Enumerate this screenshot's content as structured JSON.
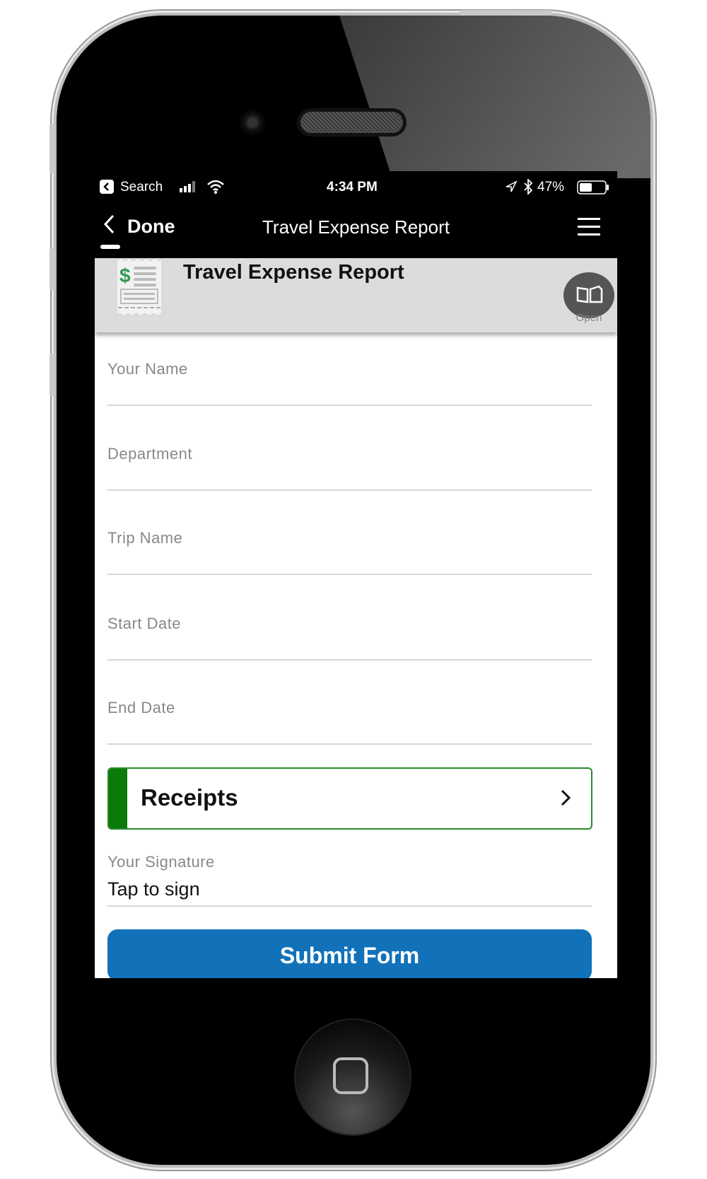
{
  "status_bar": {
    "back_app": "Search",
    "time": "4:34 PM",
    "battery": "47%",
    "battery_level": 0.47,
    "icons": [
      "back-to-app-icon",
      "signal-icon",
      "wifi-icon",
      "location-icon",
      "bluetooth-icon",
      "battery-icon"
    ]
  },
  "nav": {
    "back_label": "Done",
    "title": "Travel Expense Report",
    "menu_icon": "hamburger-menu-icon"
  },
  "header": {
    "title": "Travel Expense Report",
    "form_icon": "receipt-dollar-icon",
    "open_label": "Open",
    "open_icon": "book-icon"
  },
  "form": {
    "fields": [
      {
        "label": "Your Name",
        "value": ""
      },
      {
        "label": "Department",
        "value": ""
      },
      {
        "label": "Trip Name",
        "value": ""
      },
      {
        "label": "Start Date",
        "value": ""
      },
      {
        "label": "End Date",
        "value": ""
      }
    ],
    "receipts_label": "Receipts",
    "signature_label": "Your Signature",
    "signature_placeholder": "Tap to sign",
    "submit_label": "Submit Form"
  },
  "colors": {
    "accent_green": "#0a7a0a",
    "submit_blue": "#1172ba",
    "header_gray": "#dcdcdc"
  }
}
